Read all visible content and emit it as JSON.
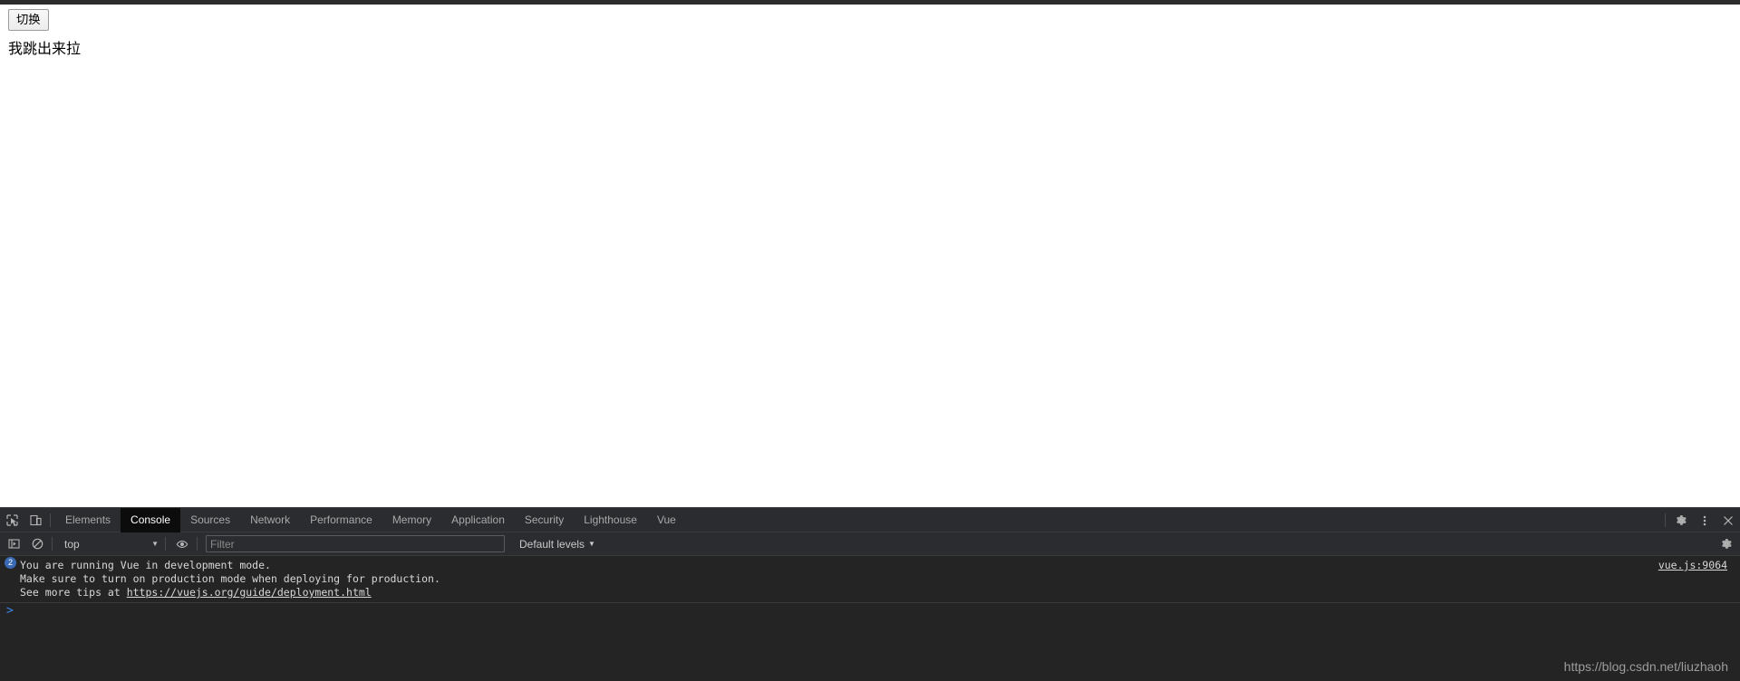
{
  "page": {
    "toggle_button_label": "切换",
    "body_text": "我跳出来拉"
  },
  "devtools": {
    "icons": {
      "inspect": "inspect-element-icon",
      "device": "device-toolbar-icon",
      "settings": "gear-icon",
      "more": "kebab-menu-icon",
      "close": "close-icon",
      "sidebar": "console-sidebar-icon",
      "clear": "clear-console-icon",
      "eye": "live-expression-icon",
      "console_settings": "gear-icon"
    },
    "tabs": [
      {
        "label": "Elements",
        "active": false
      },
      {
        "label": "Console",
        "active": true
      },
      {
        "label": "Sources",
        "active": false
      },
      {
        "label": "Network",
        "active": false
      },
      {
        "label": "Performance",
        "active": false
      },
      {
        "label": "Memory",
        "active": false
      },
      {
        "label": "Application",
        "active": false
      },
      {
        "label": "Security",
        "active": false
      },
      {
        "label": "Lighthouse",
        "active": false
      },
      {
        "label": "Vue",
        "active": false
      }
    ],
    "toolbar": {
      "context_value": "top",
      "context_caret": "▼",
      "filter_value": "",
      "filter_placeholder": "Filter",
      "levels_label": "Default levels",
      "levels_caret": "▼"
    },
    "console": {
      "messages": [
        {
          "count": "2",
          "source": "vue.js:9064",
          "lines": [
            {
              "text": "You are running Vue in development mode."
            },
            {
              "text": "Make sure to turn on production mode when deploying for production."
            },
            {
              "text": "See more tips at ",
              "link": "https://vuejs.org/guide/deployment.html"
            }
          ]
        }
      ],
      "prompt_caret": ">",
      "prompt_value": "",
      "prompt_placeholder": ""
    },
    "watermark": "https://blog.csdn.net/liuzhaoh",
    "colors": {
      "tabbar_bg": "#2b2c2f",
      "console_bg": "#242424",
      "active_tab_bg": "#0c0c0c",
      "badge_blue": "#3b6ab5",
      "prompt_blue": "#3b86e8",
      "text": "#d8d8d8"
    }
  }
}
